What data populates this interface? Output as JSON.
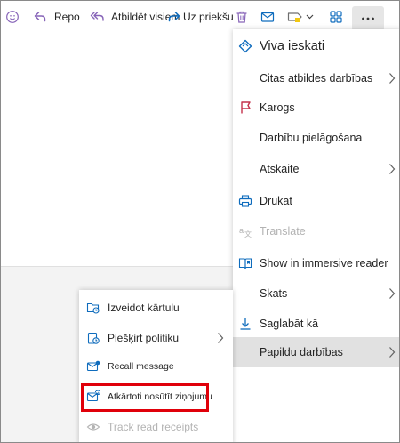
{
  "toolbar": {
    "reply_label": "Repo",
    "reply_all_label": "Atbildēt visiem",
    "forward_label": "Uz priekšu",
    "accent_color": "#8764b8",
    "icons": [
      "emoji-icon",
      "reply-icon",
      "reply-all-icon",
      "forward-icon",
      "delete-icon",
      "mail-icon",
      "label-icon",
      "chevron-down-icon",
      "apps-icon",
      "more-icon"
    ]
  },
  "main_menu": {
    "items": [
      {
        "label": "Viva ieskati",
        "icon": "viva-icon",
        "submenu": false
      },
      {
        "label": "Citas atbildes darbības",
        "icon": "",
        "submenu": true
      },
      {
        "label": "Karogs",
        "icon": "flag-icon",
        "submenu": false
      },
      {
        "label": "Darbību pielāgošana",
        "icon": "",
        "submenu": false
      },
      {
        "label": "Atskaite",
        "icon": "",
        "submenu": true
      },
      {
        "label": "Drukāt",
        "icon": "print-icon",
        "submenu": false
      },
      {
        "label": "Translate",
        "icon": "translate-icon",
        "submenu": false,
        "disabled": true
      },
      {
        "label": "Show in immersive reader",
        "icon": "immersive-reader-icon",
        "submenu": false
      },
      {
        "label": "Skats",
        "icon": "",
        "submenu": true
      },
      {
        "label": "Saglabāt kā",
        "icon": "download-icon",
        "submenu": false
      },
      {
        "label": "Papildu darbības",
        "icon": "",
        "submenu": true,
        "highlighted": true
      }
    ]
  },
  "sub_menu": {
    "items": [
      {
        "label": "Izveidot kārtulu",
        "icon": "rule-icon",
        "submenu": false
      },
      {
        "label": "Piešķirt politiku",
        "icon": "policy-icon",
        "submenu": true
      },
      {
        "label": "Recall message",
        "icon": "recall-icon",
        "submenu": false
      },
      {
        "label": "Atkārtoti nosūtīt ziņojumu",
        "icon": "resend-icon",
        "submenu": false,
        "highlighted_box": true
      },
      {
        "label": "Track read receipts",
        "icon": "read-receipt-icon",
        "submenu": false,
        "disabled": true
      }
    ]
  },
  "colors": {
    "highlight_box": "#e0000a",
    "flag": "#c4314b",
    "icon_blue": "#0f6cbd",
    "disabled": "#b3b3b3",
    "hover": "#e1e1e1"
  }
}
